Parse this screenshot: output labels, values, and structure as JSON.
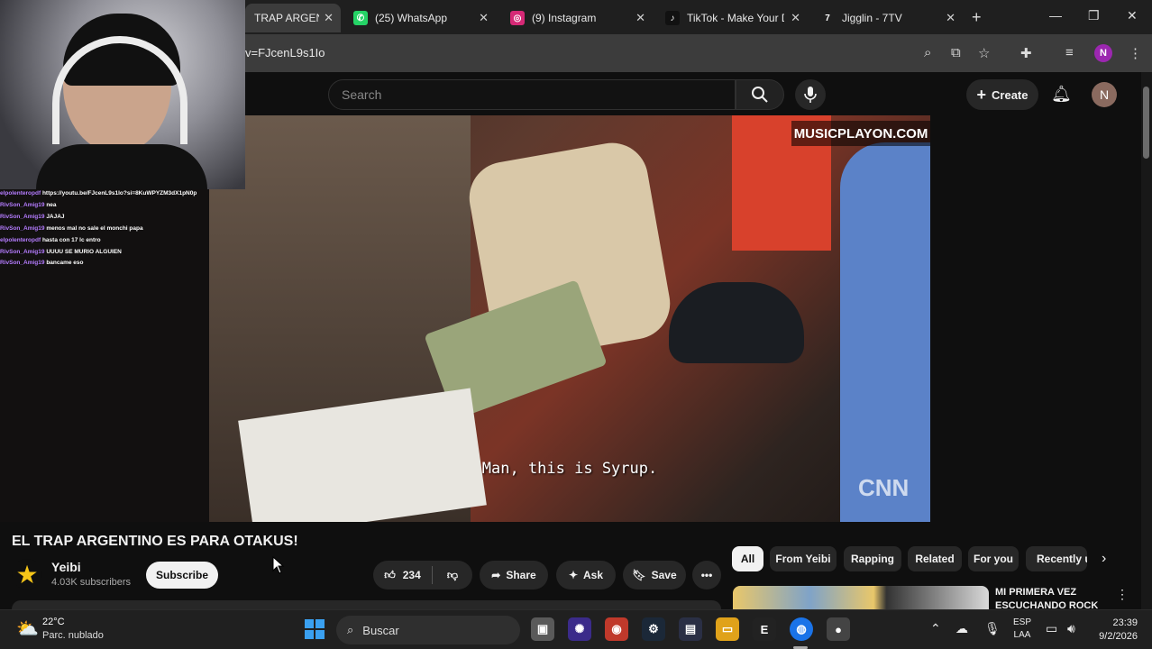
{
  "browser": {
    "tabs": [
      {
        "label": "TRAP ARGENTINO",
        "favicon": "youtube-icon",
        "active": true
      },
      {
        "label": "(25) WhatsApp",
        "favicon": "whatsapp-icon",
        "active": false
      },
      {
        "label": "(9) Instagram",
        "favicon": "instagram-icon",
        "active": false
      },
      {
        "label": "TikTok - Make Your D",
        "favicon": "tiktok-icon",
        "active": false
      },
      {
        "label": "Jigglin - 7TV",
        "favicon": "7tv-icon",
        "active": false
      }
    ],
    "url": "v=FJcenL9s1Io",
    "profile_initial": "N"
  },
  "youtube": {
    "search_placeholder": "Search",
    "create_label": "Create",
    "account_initial": "N"
  },
  "video": {
    "watermark": "MUSICPLAYON.COM",
    "subtitle": "Man, this is Syrup.",
    "network_logo": "CNN",
    "title": "EL TRAP ARGENTINO ES PARA OTAKUS!"
  },
  "channel": {
    "name": "Yeibi",
    "subscribers": "4.03K subscribers",
    "subscribe_label": "Subscribe"
  },
  "actions": {
    "likes": "234",
    "share": "Share",
    "ask": "Ask",
    "save": "Save"
  },
  "chips": [
    "All",
    "From Yeibi",
    "Rapping",
    "Related",
    "For you",
    "Recently u"
  ],
  "recommendation": {
    "title": "MI PRIMERA VEZ ESCUCHANDO ROCK"
  },
  "chat": [
    {
      "user": "elpolenteropdf",
      "msg": "https://youtu.be/FJcenL9s1Io?si=8KuWPYZM3dX1pN0p"
    },
    {
      "user": "RivSon_Amig19",
      "msg": "nea"
    },
    {
      "user": "RivSon_Amig19",
      "msg": "JAJAJ"
    },
    {
      "user": "RivSon_Amig19",
      "msg": "menos mal no sale el monchi papa"
    },
    {
      "user": "elpolenteropdf",
      "msg": "hasta con 17 lc entro"
    },
    {
      "user": "RivSon_Amig19",
      "msg": "UUUU SE MURIO ALGUIEN"
    },
    {
      "user": "RivSon_Amig19",
      "msg": "bancame eso"
    }
  ],
  "taskbar": {
    "temperature": "22°C",
    "weather": "Parc. nublado",
    "search_label": "Buscar",
    "lang_top": "ESP",
    "lang_bottom": "LAA",
    "time": "23:39",
    "date": "9/2/2026"
  },
  "colors": {
    "yt_bg": "#0f0f0f",
    "chat_user": "#b57cff",
    "accent_red": "#ff0000"
  }
}
